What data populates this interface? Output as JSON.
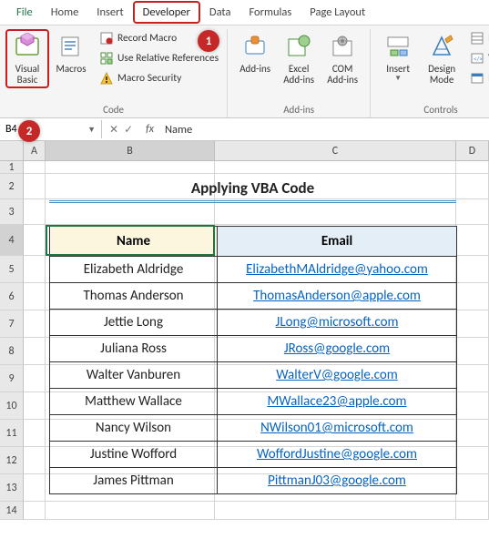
{
  "menu": {
    "tabs": [
      "File",
      "Home",
      "Insert",
      "Developer",
      "Data",
      "Formulas",
      "Page Layout"
    ],
    "active": "Developer"
  },
  "ribbon": {
    "code": {
      "label": "Code",
      "visual_basic": "Visual Basic",
      "macros": "Macros",
      "record_macro": "Record Macro",
      "use_relative": "Use Relative References",
      "macro_security": "Macro Security"
    },
    "addins": {
      "label": "Add-ins",
      "addins_btn": "Add-ins",
      "excel_addins": "Excel Add-ins",
      "com_addins": "COM Add-ins"
    },
    "controls": {
      "label": "Controls",
      "insert": "Insert",
      "design_mode": "Design Mode",
      "properties": "Pro",
      "view_code": "Vie",
      "run_dialog": "Ru"
    }
  },
  "callouts": {
    "c1": "1",
    "c2": "2"
  },
  "namebox": "B4",
  "formula": "Name",
  "columns": [
    "A",
    "B",
    "C",
    "D"
  ],
  "rows": [
    "1",
    "2",
    "3",
    "4",
    "5",
    "6",
    "7",
    "8",
    "9",
    "10",
    "11",
    "12",
    "13",
    "14"
  ],
  "sheet_title": "Applying VBA Code",
  "chart_data": {
    "type": "table",
    "headers": [
      "Name",
      "Email"
    ],
    "rows": [
      [
        "Elizabeth Aldridge",
        "ElizabethMAldridge@yahoo.com"
      ],
      [
        "Thomas Anderson",
        "ThomasAnderson@apple.com"
      ],
      [
        "Jettie Long",
        "JLong@microsoft.com"
      ],
      [
        "Juliana Ross",
        "JRoss@google.com"
      ],
      [
        "Walter Vanburen",
        "WalterV@google.com"
      ],
      [
        "Matthew Wallace",
        "MWallace23@apple.com"
      ],
      [
        "Nancy Wilson",
        "NWilson01@microsoft.com"
      ],
      [
        "Justine Wofford",
        "WoffordJustine@google.com"
      ],
      [
        "James Pittman",
        "PittmanJ03@google.com"
      ]
    ]
  }
}
